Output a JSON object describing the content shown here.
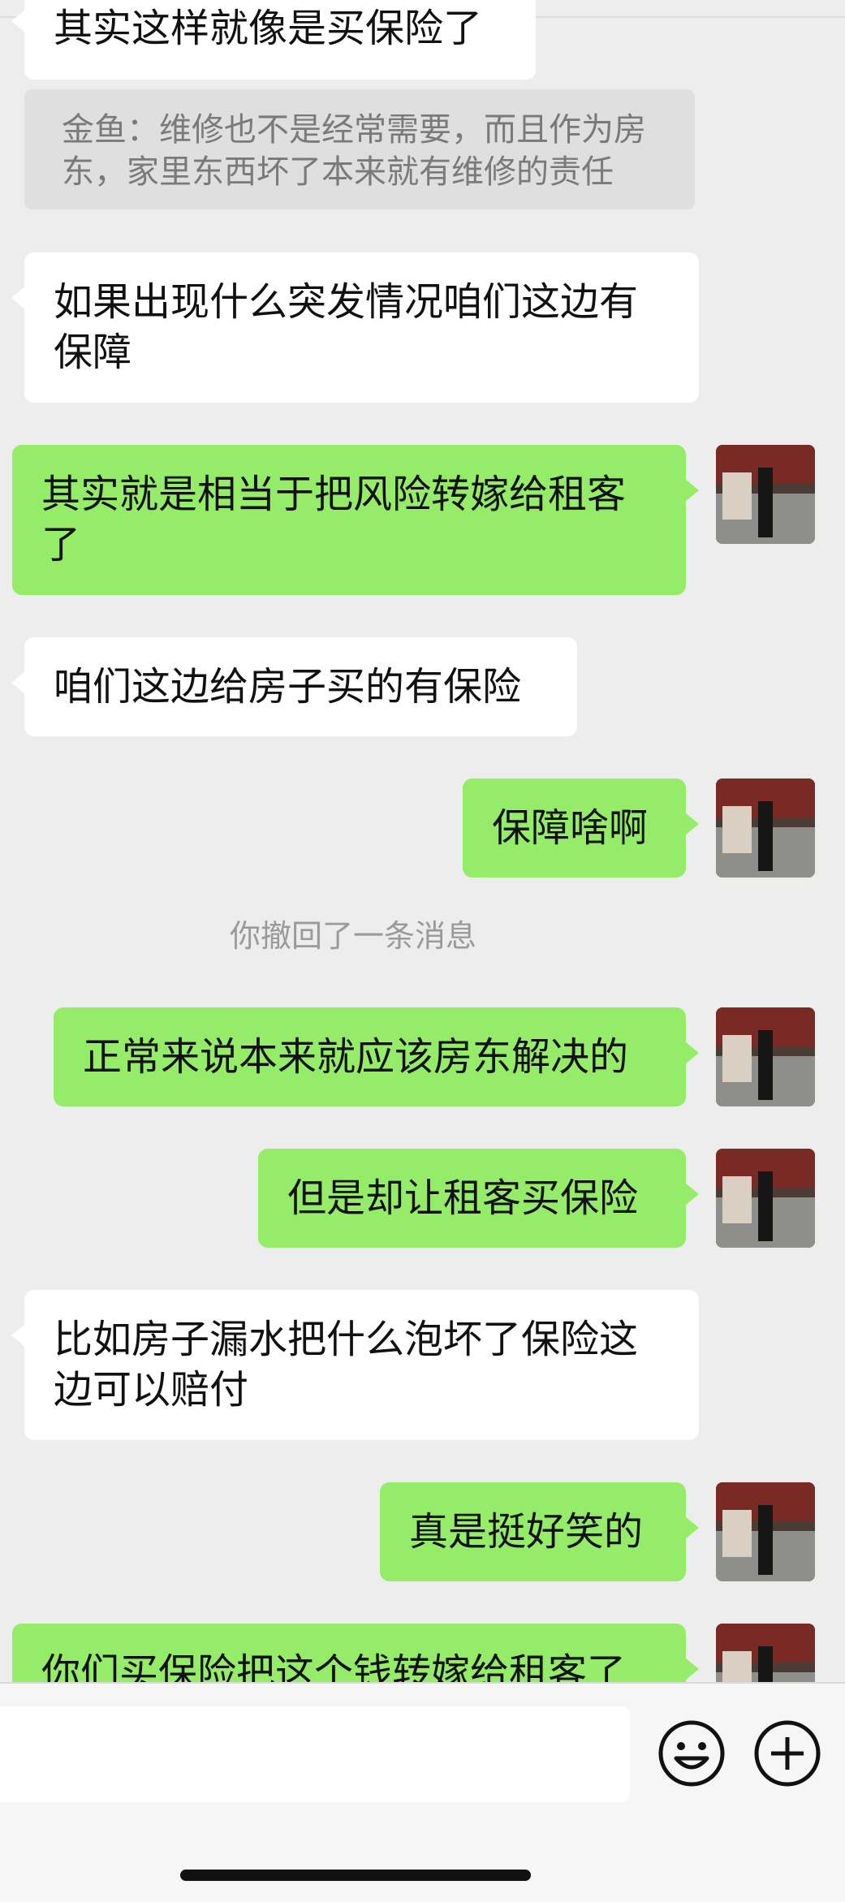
{
  "messages": [
    {
      "side": "in",
      "text": "其实这样就像是买保险了"
    },
    {
      "kind": "quote",
      "text": "金鱼：维修也不是经常需要，而且作为房东，家里东西坏了本来就有维修的责任"
    },
    {
      "side": "in",
      "text": "如果出现什么突发情况咱们这边有保障"
    },
    {
      "side": "out",
      "text": "其实就是相当于把风险转嫁给租客了"
    },
    {
      "side": "in",
      "text": "咱们这边给房子买的有保险"
    },
    {
      "side": "out",
      "text": "保障啥啊"
    },
    {
      "kind": "system",
      "text": "你撤回了一条消息"
    },
    {
      "side": "out",
      "text": "正常来说本来就应该房东解决的"
    },
    {
      "side": "out",
      "text": "但是却让租客买保险"
    },
    {
      "side": "in",
      "text": "比如房子漏水把什么泡坏了保险这边可以赔付"
    },
    {
      "side": "out",
      "text": "真是挺好笑的"
    },
    {
      "side": "out",
      "text": "你们买保险把这个钱转嫁给租客了"
    }
  ],
  "input": {
    "placeholder": "",
    "emoji_icon": "emoji-icon",
    "plus_icon": "plus-icon"
  },
  "colors": {
    "background": "#ededed",
    "bubble_out": "#95ec69",
    "bubble_in": "#ffffff"
  }
}
